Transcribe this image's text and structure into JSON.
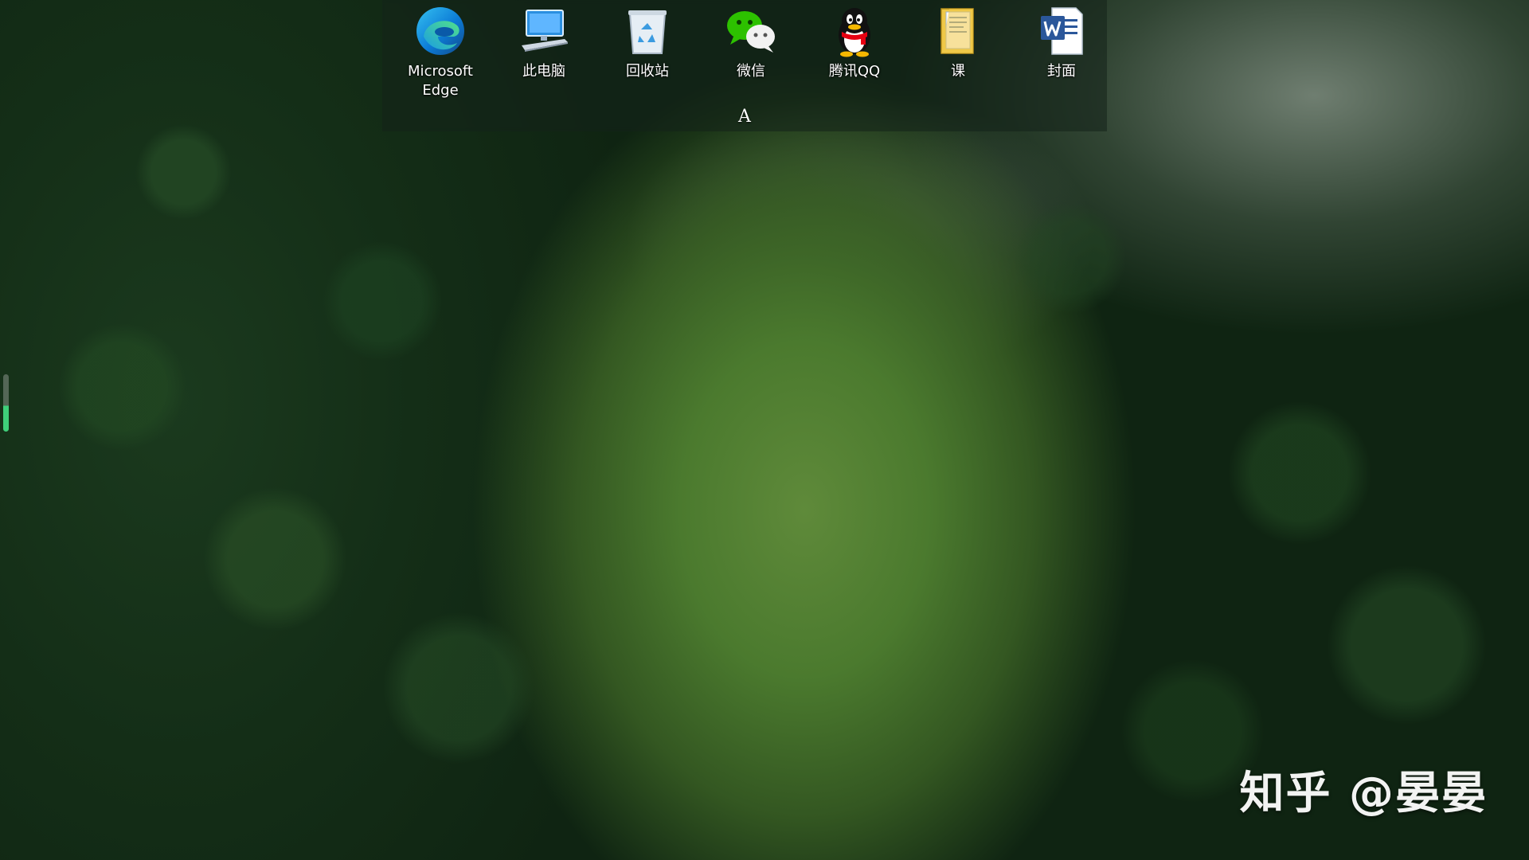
{
  "desktop": {
    "icons": [
      {
        "label": "Microsoft Edge",
        "icon": "edge-icon"
      },
      {
        "label": "此电脑",
        "icon": "this-pc-icon"
      },
      {
        "label": "回收站",
        "icon": "recycle-bin-icon"
      },
      {
        "label": "微信",
        "icon": "wechat-icon"
      },
      {
        "label": "腾讯QQ",
        "icon": "qq-icon"
      },
      {
        "label": "课",
        "icon": "folder-icon"
      },
      {
        "label": "封面",
        "icon": "word-document-icon"
      }
    ],
    "panel_letter": "A"
  },
  "watermark": "知乎 @晏晏",
  "colors": {
    "accent_green": "#3fcf7a",
    "wechat_green": "#2dc100",
    "edge_blue": "#0c7bd6",
    "word_blue": "#2b579a"
  }
}
